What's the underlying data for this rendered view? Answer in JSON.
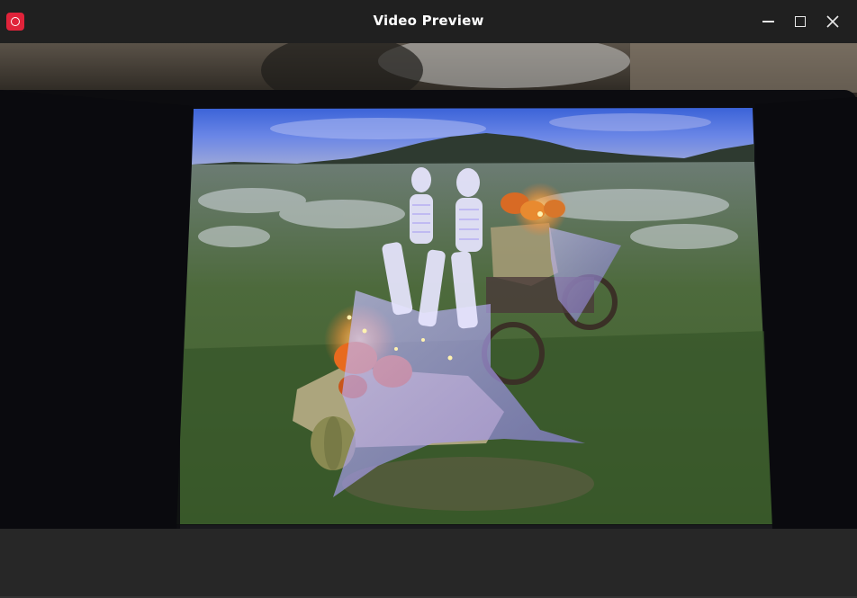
{
  "window": {
    "title": "Video Preview"
  },
  "icons": {
    "app": "app-logo-icon",
    "minimize": "minimize-icon",
    "maximize": "maximize-icon",
    "close": "close-icon"
  },
  "colors": {
    "titlebar_bg": "#202020",
    "window_bg": "#272727",
    "app_icon_accent": "#e0233a"
  }
}
